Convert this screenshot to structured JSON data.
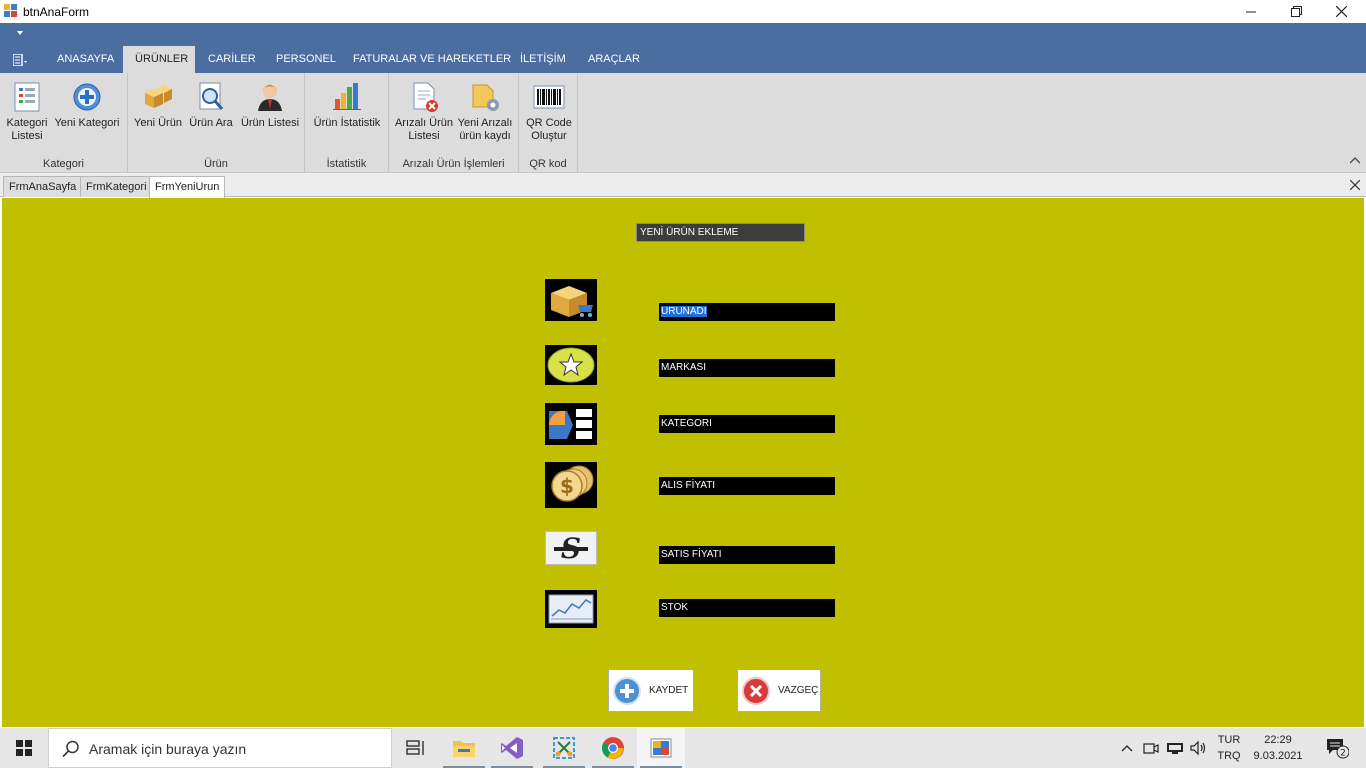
{
  "window": {
    "title": "btnAnaForm"
  },
  "ribbon_tabs": [
    "ANASAYFA",
    "ÜRÜNLER",
    "CARİLER",
    "PERSONEL",
    "FATURALAR VE HAREKETLER",
    "İLETİŞİM",
    "ARAÇLAR"
  ],
  "active_ribbon_tab": "ÜRÜNLER",
  "groups": {
    "kategori": {
      "label": "Kategori",
      "btn1_l1": "Kategori",
      "btn1_l2": "Listesi",
      "btn2": "Yeni Kategori"
    },
    "urun": {
      "label": "Ürün",
      "btn1": "Yeni Ürün",
      "btn2": "Ürün Ara",
      "btn3": "Ürün Listesi"
    },
    "istatistik": {
      "label": "İstatistik",
      "btn1": "Ürün İstatistik"
    },
    "arizali": {
      "label": "Arızalı Ürün İşlemleri",
      "btn1_l1": "Arızalı Ürün",
      "btn1_l2": "Listesi",
      "btn2_l1": "Yeni Arızalı",
      "btn2_l2": "ürün kaydı"
    },
    "qr": {
      "label": "QR kod",
      "btn1_l1": "QR Code",
      "btn1_l2": "Oluştur"
    }
  },
  "mdi_tabs": [
    "FrmAnaSayfa",
    "FrmKategori",
    "FrmYeniUrun"
  ],
  "active_mdi_tab": "FrmYeniUrun",
  "form": {
    "heading": "YENİ ÜRÜN EKLEME",
    "fields": {
      "urunadi": "URUNADI",
      "markasi": "MARKASI",
      "kategori": "KATEGORI",
      "alis": "ALIS FİYATI",
      "satis": "SATIS FİYATI",
      "stok": "STOK"
    },
    "save_label": "KAYDET",
    "cancel_label": "VAZGEÇ"
  },
  "taskbar": {
    "search_placeholder": "Aramak için buraya yazın",
    "lang_line1": "TUR",
    "lang_line2": "TRQ",
    "time": "22:29",
    "date": "9.03.2021",
    "notification_count": "2"
  },
  "colors": {
    "form_bg": "#c0c000",
    "ribbon_header": "#4a6ea0",
    "ribbon_body": "#dcdcdc"
  }
}
